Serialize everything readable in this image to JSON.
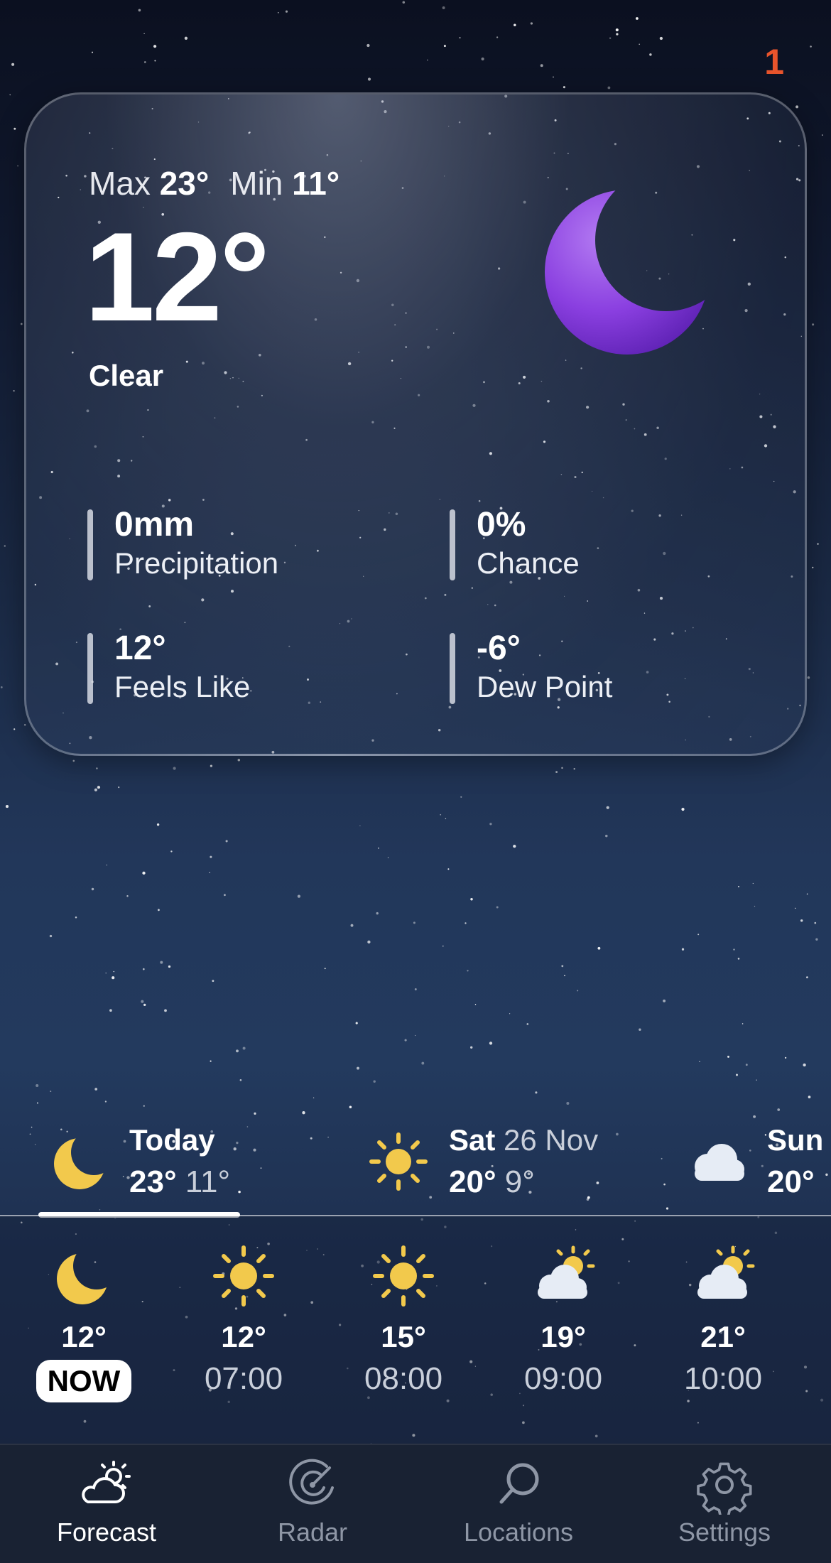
{
  "badge": "1",
  "current": {
    "max_label": "Max",
    "max_value": "23°",
    "min_label": "Min",
    "min_value": "11°",
    "temperature": "12°",
    "condition": "Clear",
    "icon": "moon-icon",
    "stats": [
      {
        "value": "0mm",
        "label": "Precipitation"
      },
      {
        "value": "0%",
        "label": "Chance"
      },
      {
        "value": "12°",
        "label": "Feels Like"
      },
      {
        "value": "-6°",
        "label": "Dew Point"
      }
    ]
  },
  "days": [
    {
      "name": "Today",
      "date": "",
      "high": "23°",
      "low": "11°",
      "icon": "moon-icon"
    },
    {
      "name": "Sat",
      "date": "26 Nov",
      "high": "20°",
      "low": "9°",
      "icon": "sun-icon"
    },
    {
      "name": "Sun",
      "date": "",
      "high": "20°",
      "low": "",
      "icon": "cloud-icon"
    }
  ],
  "hourly": [
    {
      "temp": "12°",
      "time": "NOW",
      "icon": "moon-icon"
    },
    {
      "temp": "12°",
      "time": "07:00",
      "icon": "sun-icon"
    },
    {
      "temp": "15°",
      "time": "08:00",
      "icon": "sun-icon"
    },
    {
      "temp": "19°",
      "time": "09:00",
      "icon": "partly-cloudy-icon"
    },
    {
      "temp": "21°",
      "time": "10:00",
      "icon": "partly-cloudy-icon"
    }
  ],
  "tabs": [
    {
      "label": "Forecast",
      "icon": "forecast-icon",
      "active": true
    },
    {
      "label": "Radar",
      "icon": "radar-icon",
      "active": false
    },
    {
      "label": "Locations",
      "icon": "search-icon",
      "active": false
    },
    {
      "label": "Settings",
      "icon": "gear-icon",
      "active": false
    }
  ],
  "colors": {
    "badge": "#e8542c",
    "icon_yellow": "#f2c94c",
    "moon_purple": "#8a3fe0",
    "tab_inactive": "#8e96a5"
  }
}
